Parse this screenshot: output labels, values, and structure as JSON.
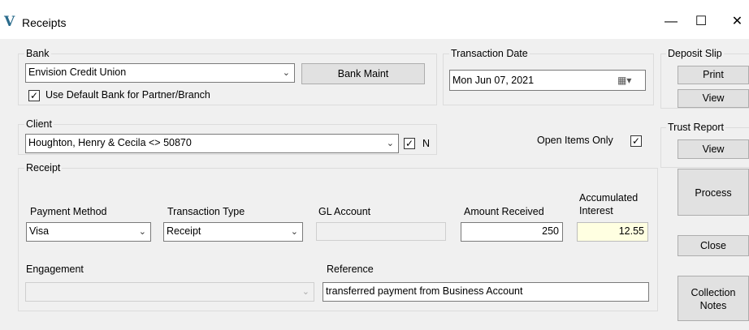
{
  "window": {
    "title": "Receipts",
    "minimize": "—",
    "maximize": "☐",
    "close": "✕"
  },
  "bank": {
    "group_label": "Bank",
    "selected": "Envision Credit Union",
    "maint_button": "Bank Maint",
    "use_default_label": "Use Default Bank for Partner/Branch",
    "use_default_checked": true
  },
  "transaction_date": {
    "group_label": "Transaction Date",
    "value": "Mon  Jun  07, 2021"
  },
  "deposit_slip": {
    "group_label": "Deposit Slip",
    "print_button": "Print",
    "view_button": "View"
  },
  "client": {
    "group_label": "Client",
    "selected": "Houghton, Henry & Cecila <> 50870",
    "n_label": "N",
    "n_checked": true,
    "open_items_label": "Open Items Only",
    "open_items_checked": true
  },
  "trust_report": {
    "group_label": "Trust Report",
    "view_button": "View"
  },
  "receipt": {
    "group_label": "Receipt",
    "payment_method_label": "Payment Method",
    "payment_method": "Visa",
    "transaction_type_label": "Transaction Type",
    "transaction_type": "Receipt",
    "gl_account_label": "GL Account",
    "gl_account": "",
    "amount_received_label": "Amount Received",
    "amount_received": "250",
    "accumulated_interest_label_1": "Accumulated",
    "accumulated_interest_label_2": "Interest",
    "accumulated_interest": "12.55",
    "engagement_label": "Engagement",
    "engagement": "",
    "reference_label": "Reference",
    "reference": "transferred payment from Business Account"
  },
  "actions": {
    "process": "Process",
    "close": "Close",
    "collection_notes_1": "Collection",
    "collection_notes_2": "Notes"
  },
  "colors": {
    "interest_field_bg": "#ffffe1",
    "window_bg": "#f0f0f0",
    "button_bg": "#e1e1e1"
  }
}
